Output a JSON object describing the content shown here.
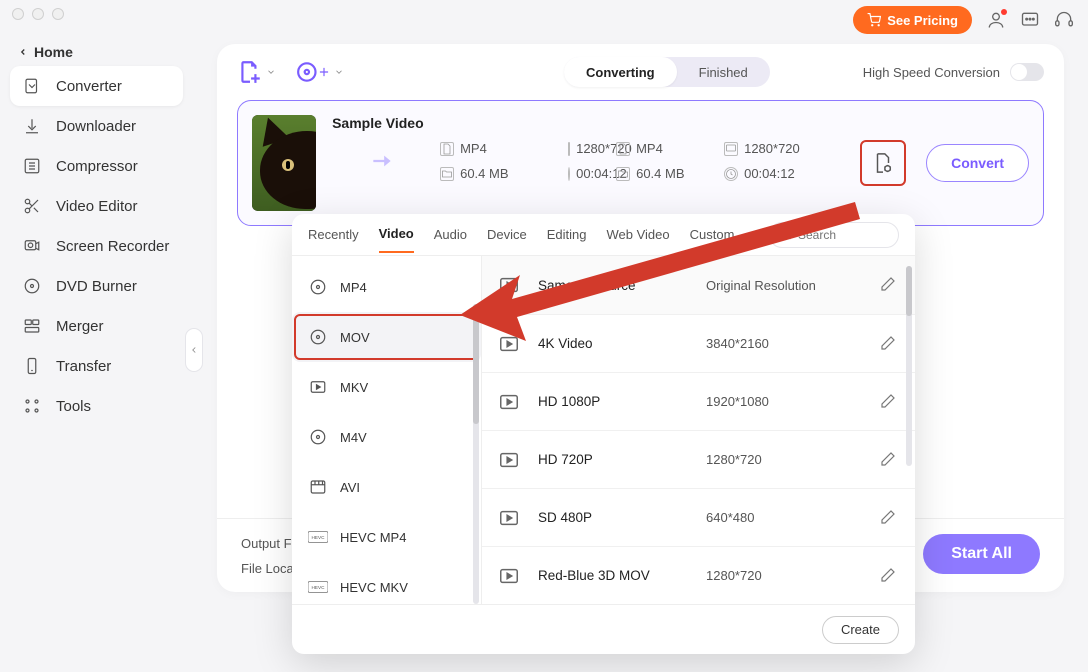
{
  "header": {
    "pricing_label": "See Pricing"
  },
  "sidebar": {
    "home": "Home",
    "items": [
      {
        "label": "Converter"
      },
      {
        "label": "Downloader"
      },
      {
        "label": "Compressor"
      },
      {
        "label": "Video Editor"
      },
      {
        "label": "Screen Recorder"
      },
      {
        "label": "DVD Burner"
      },
      {
        "label": "Merger"
      },
      {
        "label": "Transfer"
      },
      {
        "label": "Tools"
      }
    ]
  },
  "toolbar": {
    "seg": {
      "converting": "Converting",
      "finished": "Finished"
    },
    "hsc_label": "High Speed Conversion"
  },
  "file": {
    "title": "Sample Video",
    "src": {
      "fmt": "MP4",
      "res": "1280*720",
      "size": "60.4 MB",
      "dur": "00:04:12"
    },
    "dst": {
      "fmt": "MP4",
      "res": "1280*720",
      "size": "60.4 MB",
      "dur": "00:04:12"
    },
    "convert_label": "Convert"
  },
  "bottom": {
    "output_label": "Output F",
    "file_loc_label": "File Loca",
    "start_all": "Start All"
  },
  "popup": {
    "tabs": [
      "Recently",
      "Video",
      "Audio",
      "Device",
      "Editing",
      "Web Video",
      "Custom"
    ],
    "active_tab": 1,
    "search_placeholder": "Search",
    "formats": [
      "MP4",
      "MOV",
      "MKV",
      "M4V",
      "AVI",
      "HEVC MP4",
      "HEVC MKV"
    ],
    "selected_format": 1,
    "resolutions": [
      {
        "name": "Same as source",
        "dim": "Original Resolution"
      },
      {
        "name": "4K Video",
        "dim": "3840*2160"
      },
      {
        "name": "HD 1080P",
        "dim": "1920*1080"
      },
      {
        "name": "HD 720P",
        "dim": "1280*720"
      },
      {
        "name": "SD 480P",
        "dim": "640*480"
      },
      {
        "name": "Red-Blue 3D MOV",
        "dim": "1280*720"
      }
    ],
    "create_label": "Create"
  }
}
